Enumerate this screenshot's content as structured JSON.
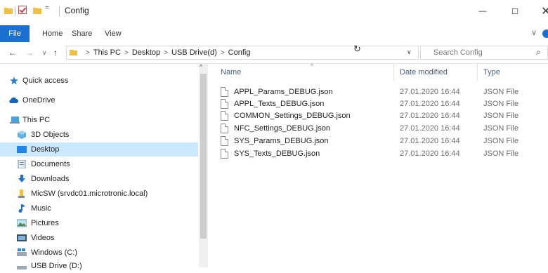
{
  "titlebar": {
    "title": "Config",
    "quick_access_dropdown": "=",
    "minimize_glyph": "—",
    "maximize_glyph": "☐",
    "close_glyph": "✕"
  },
  "ribbon": {
    "tabs": [
      "File",
      "Home",
      "Share",
      "View"
    ],
    "expand_glyph": "∨"
  },
  "address": {
    "back_glyph": "←",
    "forward_glyph": "→",
    "recent_glyph": "∨",
    "up_glyph": "↑",
    "sep_glyph": ">",
    "crumbs": [
      "This PC",
      "Desktop",
      "USB Drive(d)",
      "Config"
    ],
    "dropdown_glyph": "∨",
    "refresh_glyph": "↻",
    "search_placeholder": "Search Config",
    "search_glyph": "⌕"
  },
  "navpane": {
    "scroll_up_glyph": "^",
    "items": [
      {
        "label": "Quick access",
        "icon": "star-icon"
      },
      {
        "label": "OneDrive",
        "icon": "cloud-icon"
      },
      {
        "label": "This PC",
        "icon": "computer-icon"
      },
      {
        "label": "3D Objects",
        "icon": "cube-icon"
      },
      {
        "label": "Desktop",
        "icon": "desktop-icon",
        "selected": true
      },
      {
        "label": "Documents",
        "icon": "document-icon"
      },
      {
        "label": "Downloads",
        "icon": "download-icon"
      },
      {
        "label": "MicSW (srvdc01.microtronic.local)",
        "icon": "network-folder-icon"
      },
      {
        "label": "Music",
        "icon": "music-icon"
      },
      {
        "label": "Pictures",
        "icon": "picture-icon"
      },
      {
        "label": "Videos",
        "icon": "video-icon"
      },
      {
        "label": "Windows (C:)",
        "icon": "drive-icon"
      },
      {
        "label": "USB Drive (D:)",
        "icon": "usb-drive-icon"
      }
    ]
  },
  "filelist": {
    "sort_caret": "^",
    "columns": {
      "name": "Name",
      "date": "Date modified",
      "type": "Type"
    },
    "files": [
      {
        "name": "APPL_Params_DEBUG.json",
        "date": "27.01.2020 16:44",
        "type": "JSON File"
      },
      {
        "name": "APPL_Texts_DEBUG.json",
        "date": "27.01.2020 16:44",
        "type": "JSON File"
      },
      {
        "name": "COMMON_Settings_DEBUG.json",
        "date": "27.01.2020 16:44",
        "type": "JSON File"
      },
      {
        "name": "NFC_Settings_DEBUG.json",
        "date": "27.01.2020 16:44",
        "type": "JSON File"
      },
      {
        "name": "SYS_Params_DEBUG.json",
        "date": "27.01.2020 16:44",
        "type": "JSON File"
      },
      {
        "name": "SYS_Texts_DEBUG.json",
        "date": "27.01.2020 16:44",
        "type": "JSON File"
      }
    ]
  },
  "colors": {
    "accent": "#1a6fd1",
    "selection": "#cce8ff",
    "folder": "#f0c040",
    "header_text": "#4c607a"
  }
}
